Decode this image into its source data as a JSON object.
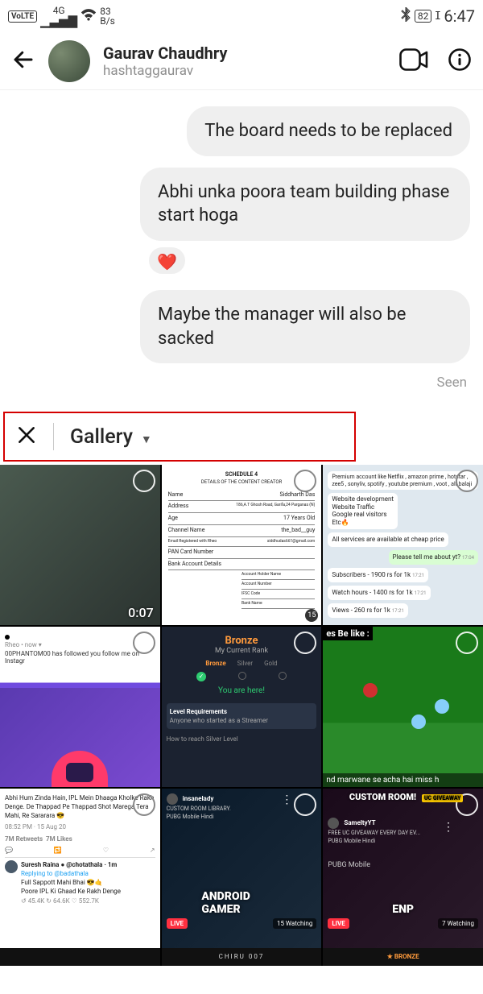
{
  "status": {
    "volte": "VoLTE",
    "net_gen": "4G",
    "speed_num": "83",
    "speed_unit": "B/s",
    "battery": "82",
    "time": "6:47"
  },
  "header": {
    "display_name": "Gaurav Chaudhry",
    "username": "hashtaggaurav"
  },
  "messages": {
    "m1": "The board needs to be replaced",
    "m2": "Abhi unka poora team building phase start hoga",
    "reaction": "❤️",
    "m3": "Maybe the manager will also be sacked",
    "seen": "Seen"
  },
  "picker": {
    "label": "Gallery"
  },
  "tiles": {
    "t1": {
      "duration": "0:07"
    },
    "t2": {
      "title": "SCHEDULE 4",
      "subtitle": "DETAILS OF THE CONTENT CREATOR",
      "r1k": "Name",
      "r1v": "Siddharth Das",
      "r2k": "Address",
      "r2v": "186,A.T Ghosh Road, Garifa,24 Parganas (N)",
      "r3k": "Age",
      "r3v": "17 Years Old",
      "r4k": "Channel Name",
      "r4v": "the_bad__guy",
      "r5k": "Email Registered with Rheo",
      "r5v": "siddhudas661@gmail.com",
      "r6k": "PAN Card Number",
      "r6v": "",
      "r7k": "Bank Account Details",
      "r7v": "",
      "sub1": "Account Holder Name",
      "sub2": "Account Number",
      "sub3": "IFSC Code",
      "sub4": "Bank Name",
      "badge": "15"
    },
    "t3": {
      "l1": "Premium account like Netflix , amazon prime , hotstar , zee5 , sonyliv, spotify , youtube premium , voot , alt balaji",
      "l2": "Website development",
      "l3": "Website Traffic",
      "l4": "Google real visitors",
      "l5": "Etc🔥",
      "l6": "All services are available at cheap price",
      "sent": "Please tell me about yt?",
      "time1": "17:04",
      "l7": "Subscribers - 1900 rs for 1k",
      "time2": "17:21",
      "l8": "Watch hours - 1400 rs for 1k",
      "time3": "17:21",
      "l9": "Views - 260 rs for 1k",
      "time4": "17:21"
    },
    "t4": {
      "src": "Rheo • now ▾",
      "line": "00PHANTOM00 has followed you follow me on Instagr"
    },
    "t5": {
      "rank_title": "Bronze",
      "rank_sub": "My Current Rank",
      "tab1": "Bronze",
      "tab2": "Silver",
      "tab3": "Gold",
      "here": "You are here!",
      "req_title": "Level Requirements",
      "req_line": "Anyone who started as a Streamer",
      "howto": "How to reach Silver Level"
    },
    "t6": {
      "top": "es Be like :",
      "bottom": "nd marwane se acha hai miss h"
    },
    "t7": {
      "tw1": "Abhi Hum Zinda Hain, IPL Mein Dhaaga Kholke Rakh Denge. De Thappad Pe Thappad Shot Marega Tera Mahi, Re Sararara 😎",
      "tweet_time": "08:52 PM · 15 Aug 20",
      "rt": "7M Retweets",
      "likes": "7M Likes",
      "reply_name": "Suresh Raina ● @chotathala · 1m",
      "reply_to": "Replying to @badathala",
      "reply1": "Full Sappott Mahi Bhai 😎🤙",
      "reply2": "Poore IPL Ki Ghaad Ke Rakh Denge",
      "s1": "↺ 45.4K",
      "s2": "↻ 64.6K",
      "s3": "♡ 552.7K"
    },
    "t8": {
      "name": "insanelady",
      "game": "CUSTOM ROOM LIBRARY.",
      "tags": "PUBG Mobile   Hindi",
      "live": "LIVE",
      "watch": "15 Watching",
      "big": "ANDROID GAMER"
    },
    "t9": {
      "top": "CUSTOM ROOM!",
      "pill": "UC GIVEAWAY",
      "name": "SameltyYT",
      "game": "FREE UC GIVEAWAY EVERY DAY EV...",
      "tags": "PUBG Mobile   Hindi",
      "cat": "PUBG Mobile",
      "live": "LIVE",
      "watch": "7 Watching",
      "big": "ENP"
    },
    "bottom": {
      "b2": "CHIRU 007",
      "b3": "★ BRONZE"
    }
  }
}
